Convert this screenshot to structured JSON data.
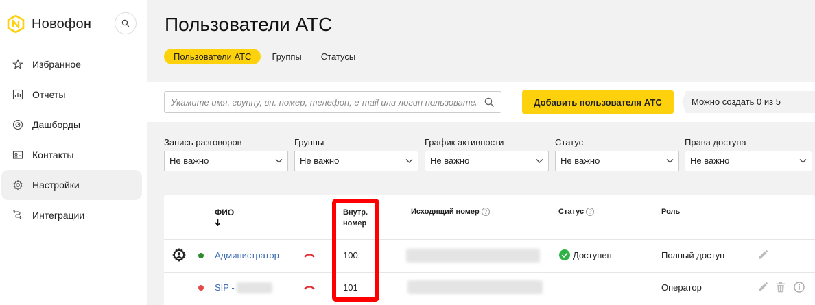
{
  "brand": {
    "name": "Новофон"
  },
  "sidebar": {
    "items": [
      {
        "label": "Избранное",
        "icon": "star-icon",
        "active": false
      },
      {
        "label": "Отчеты",
        "icon": "report-icon",
        "active": false
      },
      {
        "label": "Дашборды",
        "icon": "dashboard-icon",
        "active": false
      },
      {
        "label": "Контакты",
        "icon": "contact-card-icon",
        "active": false
      },
      {
        "label": "Настройки",
        "icon": "gear-icon",
        "active": true
      },
      {
        "label": "Интеграции",
        "icon": "integration-icon",
        "active": false
      }
    ]
  },
  "page": {
    "title": "Пользователи АТС",
    "tabs": [
      {
        "label": "Пользователи АТС",
        "active": true
      },
      {
        "label": "Группы",
        "active": false
      },
      {
        "label": "Статусы",
        "active": false
      }
    ]
  },
  "toolbar": {
    "search_placeholder": "Укажите имя, группу, вн. номер, телефон, e-mail или логин пользователя",
    "add_button": "Добавить пользователя АТС",
    "limit_note": "Можно создать 0 из 5"
  },
  "filters": [
    {
      "label": "Запись разговоров",
      "value": "Не важно"
    },
    {
      "label": "Группы",
      "value": "Не важно"
    },
    {
      "label": "График активности",
      "value": "Не важно"
    },
    {
      "label": "Статус",
      "value": "Не важно"
    },
    {
      "label": "Права доступа",
      "value": "Не важно"
    }
  ],
  "table": {
    "headers": {
      "fio": "ФИО",
      "ext_line1": "Внутр.",
      "ext_line2": "номер",
      "outgoing": "Исходящий номер",
      "status": "Статус",
      "role": "Роль"
    },
    "rows": [
      {
        "name": "Администратор",
        "ext": "100",
        "status": "Доступен",
        "role": "Полный доступ",
        "online_color": "#2e8b2e"
      },
      {
        "name": "SIP - ",
        "ext": "101",
        "status": "",
        "role": "Оператор",
        "online_color": "#e24b4b"
      }
    ]
  },
  "colors": {
    "accent": "#fdd10b",
    "link": "#3d6db6",
    "highlight": "#ff0000",
    "hangup": "#e0343c",
    "available": "#2fb344"
  }
}
